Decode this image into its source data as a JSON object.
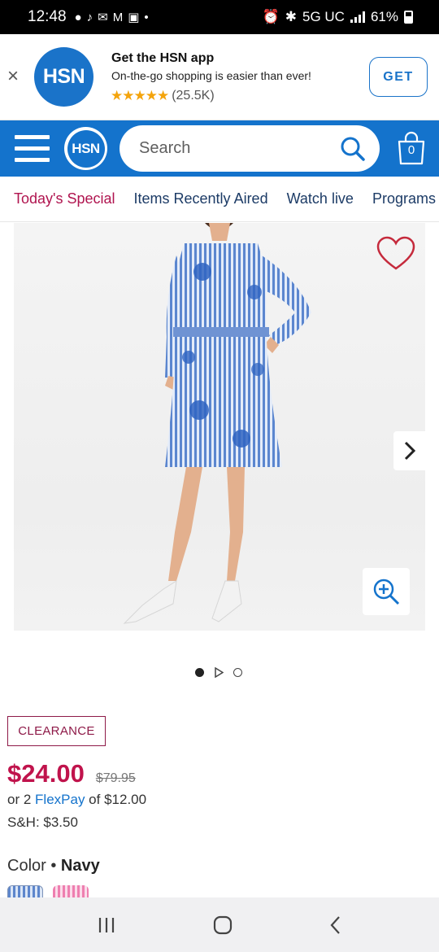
{
  "status_bar": {
    "time": "12:48",
    "network": "5G UC",
    "battery": "61%"
  },
  "app_banner": {
    "close_label": "×",
    "logo_text": "HSN",
    "title": "Get the HSN app",
    "subtitle": "On-the-go shopping is easier than ever!",
    "stars": "★★★★★",
    "rating_count": "(25.5K)",
    "get_label": "GET"
  },
  "header": {
    "logo_text": "HSN",
    "search_placeholder": "Search",
    "cart_count": "0"
  },
  "nav_tabs": [
    {
      "label": "Today's Special"
    },
    {
      "label": "Items Recently Aired"
    },
    {
      "label": "Watch live"
    },
    {
      "label": "Programs"
    }
  ],
  "product": {
    "badge": "CLEARANCE",
    "price": "$24.00",
    "original_price": "$79.95",
    "flexpay_prefix": "or 2 ",
    "flexpay_link": "FlexPay",
    "flexpay_suffix": " of $12.00",
    "shipping": "S&H: $3.50",
    "color_label": "Color • ",
    "color_value": "Navy"
  },
  "colors": {
    "brand_blue": "#1473cc",
    "price_red": "#c0134c",
    "clearance_border": "#8e1a48"
  }
}
